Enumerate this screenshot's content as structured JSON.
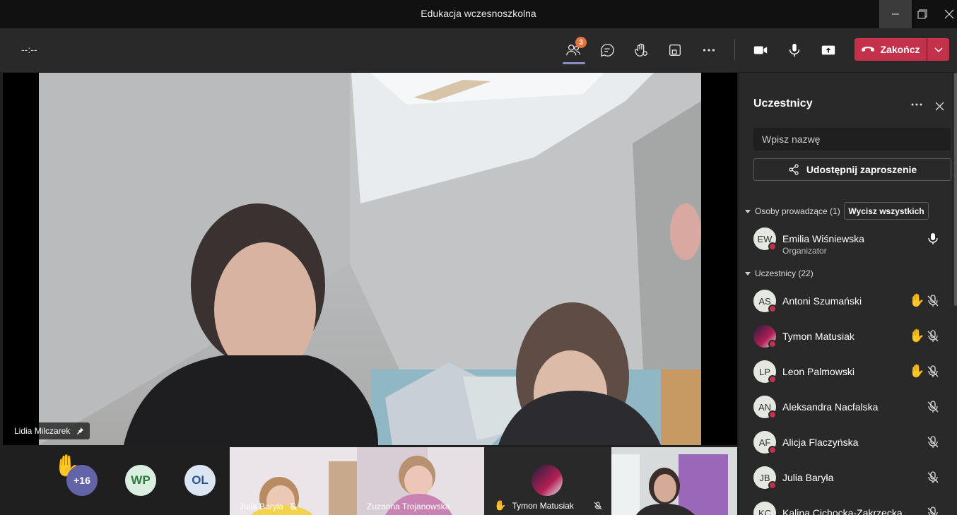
{
  "window": {
    "title": "Edukacja wczesnoszkolna"
  },
  "toolbar": {
    "timer": "--:--",
    "participants_badge": "3",
    "end_label": "Zakończ"
  },
  "stage": {
    "pinned_name": "Lidia Milczarek"
  },
  "strip": {
    "overflow_count": "+16",
    "avatars": [
      {
        "initials": "WP",
        "bg": "#dbefe1",
        "color": "#2e7d3e"
      },
      {
        "initials": "OL",
        "bg": "#dce6f3",
        "color": "#2f5496"
      }
    ],
    "thumbs": [
      {
        "name": "Julia Baryła"
      },
      {
        "name": "Zuzanna Trojanowska"
      },
      {
        "name": "Tymon Matusiak"
      }
    ]
  },
  "panel": {
    "title": "Uczestnicy",
    "search_placeholder": "Wpisz nazwę",
    "share_label": "Udostępnij zaproszenie",
    "presenters_header": "Osoby prowadzące (1)",
    "mute_all_label": "Wycisz wszystkich",
    "attendees_header": "Uczestnicy (22)",
    "presenter": {
      "initials": "EW",
      "name": "Emilia Wiśniewska",
      "role": "Organizator"
    },
    "attendees": [
      {
        "initials": "AS",
        "name": "Antoni Szumański",
        "hand": true
      },
      {
        "initials": "",
        "name": "Tymon Matusiak",
        "hand": true
      },
      {
        "initials": "LP",
        "name": "Leon Palmowski",
        "hand": true
      },
      {
        "initials": "AN",
        "name": "Aleksandra Nacfalska",
        "hand": false
      },
      {
        "initials": "AF",
        "name": "Alicja Flaczyńska",
        "hand": false
      },
      {
        "initials": "JB",
        "name": "Julia Baryła",
        "hand": false
      },
      {
        "initials": "KC",
        "name": "Kalina Cichocka-Zakrzecka",
        "hand": false
      }
    ]
  },
  "colors": {
    "accent": "#8b8cc7",
    "end": "#c4314b",
    "badge": "#e3743f",
    "panel_bg": "#292929"
  }
}
